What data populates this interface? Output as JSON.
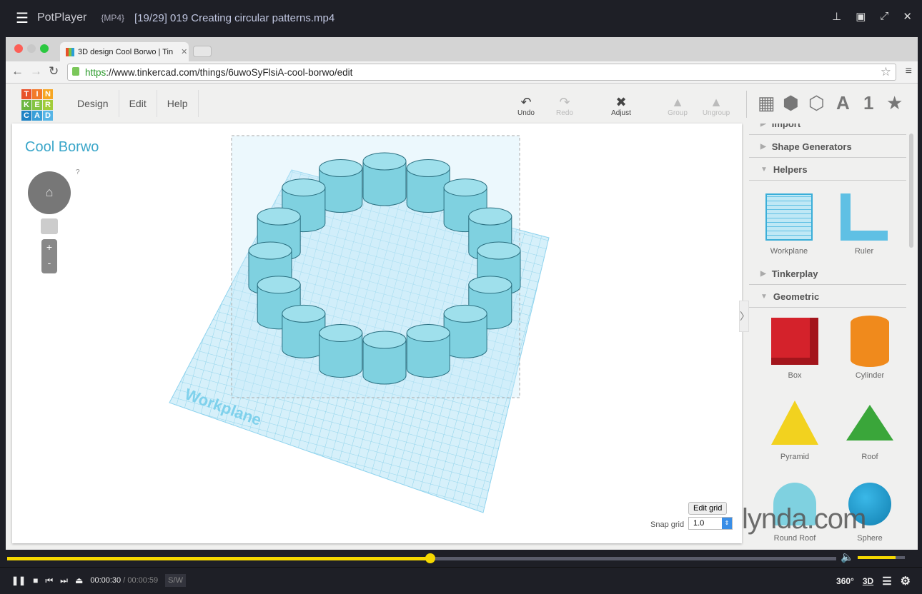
{
  "player": {
    "app_name": "PotPlayer",
    "format": "{MP4}",
    "file_title": "[19/29] 019 Creating circular patterns.mp4",
    "current_time": "00:00:30",
    "total_time": "00:00:59",
    "sw_label": "S/W",
    "progress_percent": 51,
    "volume_percent": 80,
    "right_controls": [
      "360°",
      "3D"
    ]
  },
  "browser": {
    "tab_title": "3D design Cool Borwo | Tin",
    "url_scheme": "https",
    "url_rest": "://www.tinkercad.com/things/6uwoSyFlsiA-cool-borwo/edit"
  },
  "app": {
    "logo_letters": [
      "T",
      "I",
      "N",
      "K",
      "E",
      "R",
      "C",
      "A",
      "D"
    ],
    "menu": [
      "Design",
      "Edit",
      "Help"
    ],
    "toolbar": [
      {
        "label": "Undo",
        "enabled": true
      },
      {
        "label": "Redo",
        "enabled": false
      },
      {
        "label": "Adjust",
        "enabled": true
      },
      {
        "label": "Group",
        "enabled": false
      },
      {
        "label": "Ungroup",
        "enabled": false
      }
    ],
    "design_name": "Cool Borwo",
    "help_mark": "?",
    "workplane_label": "Workplane",
    "edit_grid": "Edit grid",
    "snap_grid_label": "Snap grid",
    "snap_grid_value": "1.0",
    "watermark": "lynda.com",
    "panel": {
      "sections": [
        "Import",
        "Shape Generators",
        "Helpers",
        "Tinkerplay",
        "Geometric"
      ],
      "helpers": [
        "Workplane",
        "Ruler"
      ],
      "geometric": [
        "Box",
        "Cylinder",
        "Pyramid",
        "Roof",
        "Round Roof",
        "Sphere"
      ]
    }
  },
  "colors": {
    "accent": "#f5d800",
    "shape": "#7fd1e0",
    "workplane": "#bfe8f5"
  }
}
